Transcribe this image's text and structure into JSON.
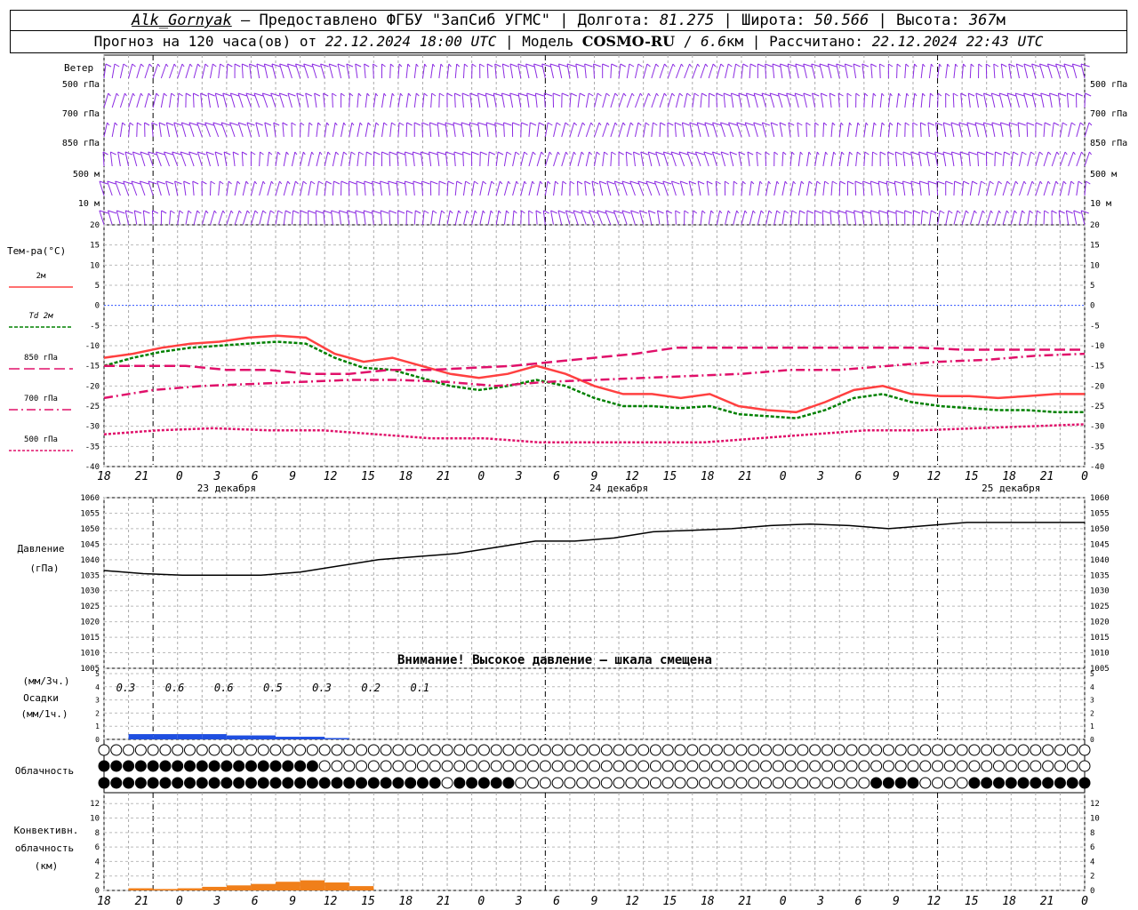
{
  "header": {
    "station": "Alk_Gornyak",
    "dash": " – ",
    "provider": "Предоставлено ФГБУ \"ЗапСиб УГМС\"",
    "lon_label": "Долгота:",
    "lon_value": "81.275",
    "lat_label": "Широта:",
    "lat_value": "50.566",
    "alt_label": "Высота:",
    "alt_value": "367",
    "alt_unit": "м",
    "forecast_prefix": "Прогноз на 120 часа(ов) от",
    "forecast_time": "22.12.2024 18:00 UTC",
    "model_label": "Модель",
    "model_name": "COSMO-RU",
    "model_res": "6.6",
    "model_res_unit": "км",
    "calc_label": "Рассчитано:",
    "calc_time": "22.12.2024 22:43 UTC"
  },
  "wind_panel": {
    "title": "Ветер",
    "levels": [
      "500 гПа",
      "700 гПа",
      "850 гПа",
      "500 м",
      "10  м"
    ],
    "barb_color": "#8b2be2"
  },
  "temp_panel": {
    "title": "Тем-ра(°C)",
    "legend": [
      {
        "label": "2м",
        "color": "#ff4040",
        "dash": ""
      },
      {
        "label": "Td 2м",
        "color": "#008000",
        "dash": "4,2"
      },
      {
        "label": "850 гПа",
        "color": "#e0106a",
        "dash": "12,5"
      },
      {
        "label": "700 гПа",
        "color": "#e0106a",
        "dash": "10,4,2,4"
      },
      {
        "label": "500 гПа",
        "color": "#e0106a",
        "dash": "3,2"
      }
    ],
    "ticks": [
      "20",
      "15",
      "10",
      "5",
      "0",
      "-5",
      "-10",
      "-15",
      "-20",
      "-25",
      "-30",
      "-35",
      "-40"
    ],
    "hours": [
      "18",
      "21",
      "0",
      "3",
      "6",
      "9",
      "12",
      "15",
      "18",
      "21",
      "0",
      "3",
      "6",
      "9",
      "12",
      "15",
      "18",
      "21",
      "0",
      "3",
      "6",
      "9",
      "12",
      "15",
      "18",
      "21",
      "0"
    ],
    "days": [
      "23 декабря",
      "24 декабря",
      "25 декабря"
    ]
  },
  "pressure_panel": {
    "title1": "Давление",
    "title2": "(гПа)",
    "ticks": [
      "1060",
      "1055",
      "1050",
      "1045",
      "1040",
      "1035",
      "1030",
      "1025",
      "1020",
      "1015",
      "1010",
      "1005"
    ],
    "warning": "Внимание! Высокое давление – шкала смещена"
  },
  "precip_panel": {
    "title1": "(мм/3ч.)",
    "title2": "Осадки",
    "title3": "(мм/1ч.)",
    "ticks": [
      "5",
      "4",
      "3",
      "2",
      "1",
      "0"
    ],
    "sums": [
      "0.3",
      "0.6",
      "0.6",
      "0.5",
      "0.3",
      "0.2",
      "0.1"
    ]
  },
  "cloud_panel": {
    "title": "Облачность"
  },
  "conv_panel": {
    "title1": "Конвективн.",
    "title2": "облачность",
    "title3": "(км)",
    "ticks": [
      "12",
      "10",
      "8",
      "6",
      "4",
      "2",
      "0"
    ]
  },
  "chart_data": {
    "type": "line",
    "x_hours_from_start": [
      0,
      3,
      6,
      9,
      12,
      15,
      18,
      21,
      24,
      27,
      30,
      33,
      36,
      39,
      42,
      45,
      48,
      51,
      54,
      57,
      60,
      63,
      66,
      69,
      72,
      75,
      78,
      81,
      84,
      87,
      90,
      93,
      96,
      99,
      102,
      105,
      108,
      111,
      114,
      117,
      120
    ],
    "temperature": {
      "ylim": [
        -40,
        20
      ],
      "series": [
        {
          "name": "2м",
          "values": [
            -13,
            -12,
            -10.5,
            -9.5,
            -9,
            -8,
            -7.5,
            -8,
            -12,
            -14,
            -13,
            -15,
            -17,
            -18,
            -17,
            -15,
            -17,
            -20,
            -22,
            -22,
            -23,
            -22,
            -25,
            -26,
            -26.5,
            -24,
            -21,
            -20,
            -22,
            -22.5,
            -22.5,
            -23,
            -22.5,
            -22,
            -22
          ]
        },
        {
          "name": "Td 2м",
          "values": [
            -15,
            -13,
            -11.5,
            -10.5,
            -10,
            -9.5,
            -9,
            -9.5,
            -13,
            -15.5,
            -16,
            -18,
            -20,
            -21,
            -20,
            -18.5,
            -20,
            -23,
            -25,
            -25,
            -25.5,
            -25,
            -27,
            -27.5,
            -28,
            -26,
            -23,
            -22,
            -24,
            -25,
            -25.5,
            -26,
            -26,
            -26.5,
            -26.5
          ]
        },
        {
          "name": "850 гПа",
          "values": [
            -15,
            -15,
            -15,
            -16,
            -16,
            -17,
            -17,
            -16,
            -16,
            -15.5,
            -15,
            -14,
            -13,
            -12,
            -10.5,
            -10.5,
            -10.5,
            -10.5,
            -10.5,
            -10.5,
            -10.5,
            -11,
            -11,
            -11,
            -11
          ]
        },
        {
          "name": "700 гПа",
          "values": [
            -23,
            -21,
            -20,
            -19.5,
            -19,
            -18.5,
            -18.5,
            -19,
            -20,
            -19,
            -18.5,
            -18,
            -17.5,
            -17,
            -16,
            -16,
            -15,
            -14,
            -13.5,
            -12.5,
            -12
          ]
        },
        {
          "name": "500 гПа",
          "values": [
            -32,
            -31,
            -30.5,
            -31,
            -31,
            -32,
            -33,
            -33,
            -34,
            -34,
            -34,
            -34,
            -33,
            -32,
            -31,
            -31,
            -30.5,
            -30,
            -29.5
          ]
        }
      ]
    },
    "pressure": {
      "ylim": [
        1005,
        1060
      ],
      "values": [
        1036.5,
        1035.5,
        1035,
        1035,
        1035,
        1036,
        1038,
        1040,
        1041,
        1042,
        1044,
        1046,
        1046,
        1047,
        1049,
        1049.5,
        1050,
        1051,
        1051.5,
        1051,
        1050,
        1051,
        1052,
        1052,
        1052,
        1052
      ]
    },
    "precip_1h": [
      0,
      0.4,
      0.4,
      0.4,
      0.4,
      0.3,
      0.3,
      0.2,
      0.2,
      0.1
    ],
    "convective_cloud_km": [
      0,
      0.3,
      0.2,
      0.3,
      0.5,
      0.7,
      0.9,
      1.2,
      1.4,
      1.1,
      0.6
    ]
  }
}
